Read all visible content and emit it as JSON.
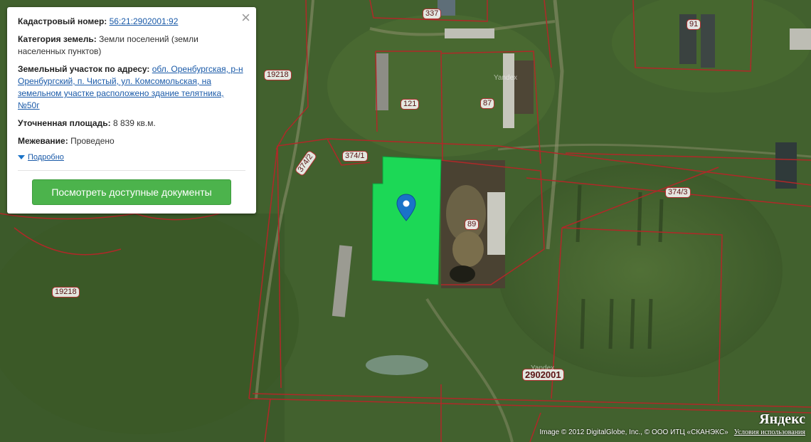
{
  "popup": {
    "cadastral_label": "Кадастровый номер:",
    "cadastral_value": "56:21:2902001:92",
    "category_label": "Категория земель:",
    "category_value": "Земли поселений (земли населенных пунктов)",
    "address_label": "Земельный участок по адресу:",
    "address_value": "обл. Оренбургская, р-н Оренбургский, п. Чистый, ул. Комсомольская, на земельном участке расположено здание телятника, №50г",
    "area_label": "Уточненная площадь:",
    "area_value": "8 839 кв.м.",
    "survey_label": "Межевание:",
    "survey_value": "Проведено",
    "details_link": "Подробно",
    "documents_button": "Посмотреть доступные документы",
    "close_icon": "close-icon"
  },
  "map": {
    "plot_labels": [
      "337",
      "91",
      "19218",
      "121",
      "87",
      "374/1",
      "374/2",
      "374/3",
      "89",
      "19218",
      "2902001"
    ],
    "watermarks": [
      "Yandex",
      "Yandex"
    ],
    "selected_color": "#19e35a",
    "boundary_color": "#b02828",
    "marker_icon": "map-pin-icon"
  },
  "footer": {
    "brand": "Яндекс",
    "copyright": "Image © 2012 DigitalGlobe, Inc., © ООО ИТЦ «СКАНЭКС»",
    "terms": "Условия использования"
  }
}
